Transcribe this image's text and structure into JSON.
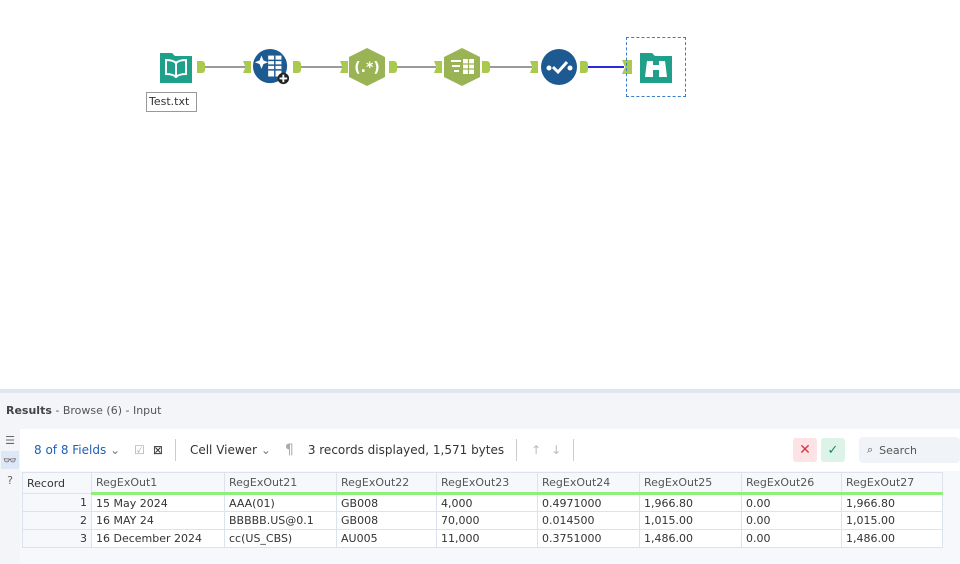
{
  "canvas": {
    "input_label": "Test.txt",
    "tools": [
      {
        "name": "Input Data",
        "icon": "book-icon",
        "color": "#1fa08a"
      },
      {
        "name": "Data Cleansing",
        "icon": "cleanse-icon",
        "color": "#1d5a92"
      },
      {
        "name": "RegEx",
        "icon": "regex-icon",
        "color": "#9ab354",
        "glyph": "(.*)"
      },
      {
        "name": "Text to Columns",
        "icon": "text-columns-icon",
        "color": "#9ab354"
      },
      {
        "name": "Auto Field",
        "icon": "check-icon",
        "color": "#1d5a92"
      },
      {
        "name": "Browse",
        "icon": "binoculars-icon",
        "color": "#1fa08a"
      }
    ]
  },
  "results": {
    "title": "Results",
    "subtitle": " - Browse (6) - Input"
  },
  "toolbar": {
    "fields": "8 of 8 Fields",
    "cell_viewer": "Cell Viewer",
    "status": "3 records displayed, 1,571 bytes",
    "search_placeholder": "Search"
  },
  "table": {
    "columns": [
      "Record",
      "RegExOut1",
      "RegExOut21",
      "RegExOut22",
      "RegExOut23",
      "RegExOut24",
      "RegExOut25",
      "RegExOut26",
      "RegExOut27"
    ],
    "rows": [
      [
        "1",
        "15 May 2024",
        "AAA(01)",
        "GB008",
        "4,000",
        "0.4971000",
        "1,966.80",
        "0.00",
        "1,966.80"
      ],
      [
        "2",
        "16 MAY 24",
        "BBBBB.US@0.1",
        "GB008",
        "70,000",
        "0.014500",
        "1,015.00",
        "0.00",
        "1,015.00"
      ],
      [
        "3",
        "16 December 2024",
        "cc(US_CBS)",
        "AU005",
        "11,000",
        "0.3751000",
        "1,486.00",
        "0.00",
        "1,486.00"
      ]
    ]
  }
}
